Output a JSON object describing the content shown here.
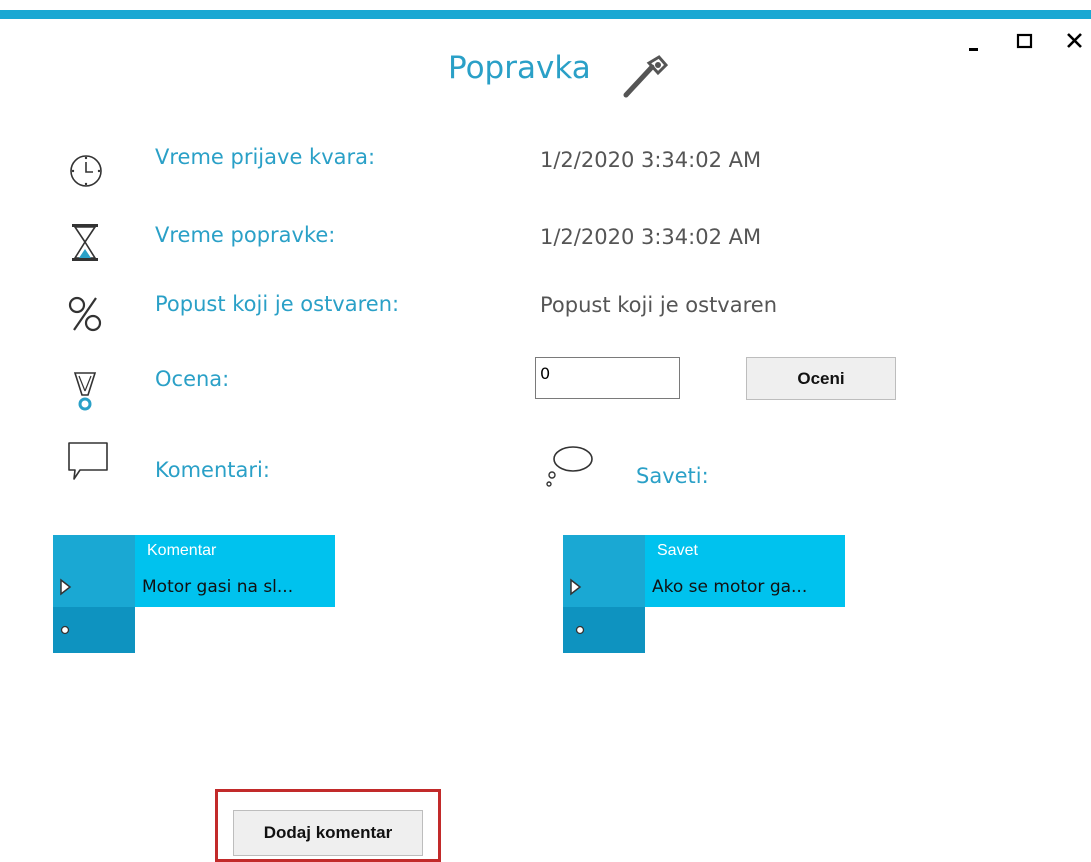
{
  "window": {
    "title": "Popravka",
    "controls": {
      "minimize": "-",
      "maximize": "□",
      "close": "X"
    }
  },
  "fields": [
    {
      "icon": "clock-icon",
      "label": "Vreme prijave kvara:",
      "value": "1/2/2020 3:34:02 AM"
    },
    {
      "icon": "hourglass-icon",
      "label": "Vreme popravke:",
      "value": "1/2/2020 3:34:02 AM"
    },
    {
      "icon": "percent-icon",
      "label": "Popust koji je ostvaren:",
      "value": "Popust koji je ostvaren"
    }
  ],
  "rating": {
    "label": "Ocena:",
    "input_value": "0",
    "button": "Oceni"
  },
  "comments": {
    "label": "Komentari:",
    "grid": {
      "column": "Komentar",
      "rows": [
        "Motor gasi na sl..."
      ]
    }
  },
  "tips": {
    "label": "Saveti:",
    "grid": {
      "column": "Savet",
      "rows": [
        "Ako se motor ga..."
      ]
    }
  },
  "add_comment_button": "Dodaj komentar",
  "colors": {
    "accent": "#1aa8d3",
    "grid_header": "#00c2ee",
    "highlight": "#c22a2a"
  }
}
